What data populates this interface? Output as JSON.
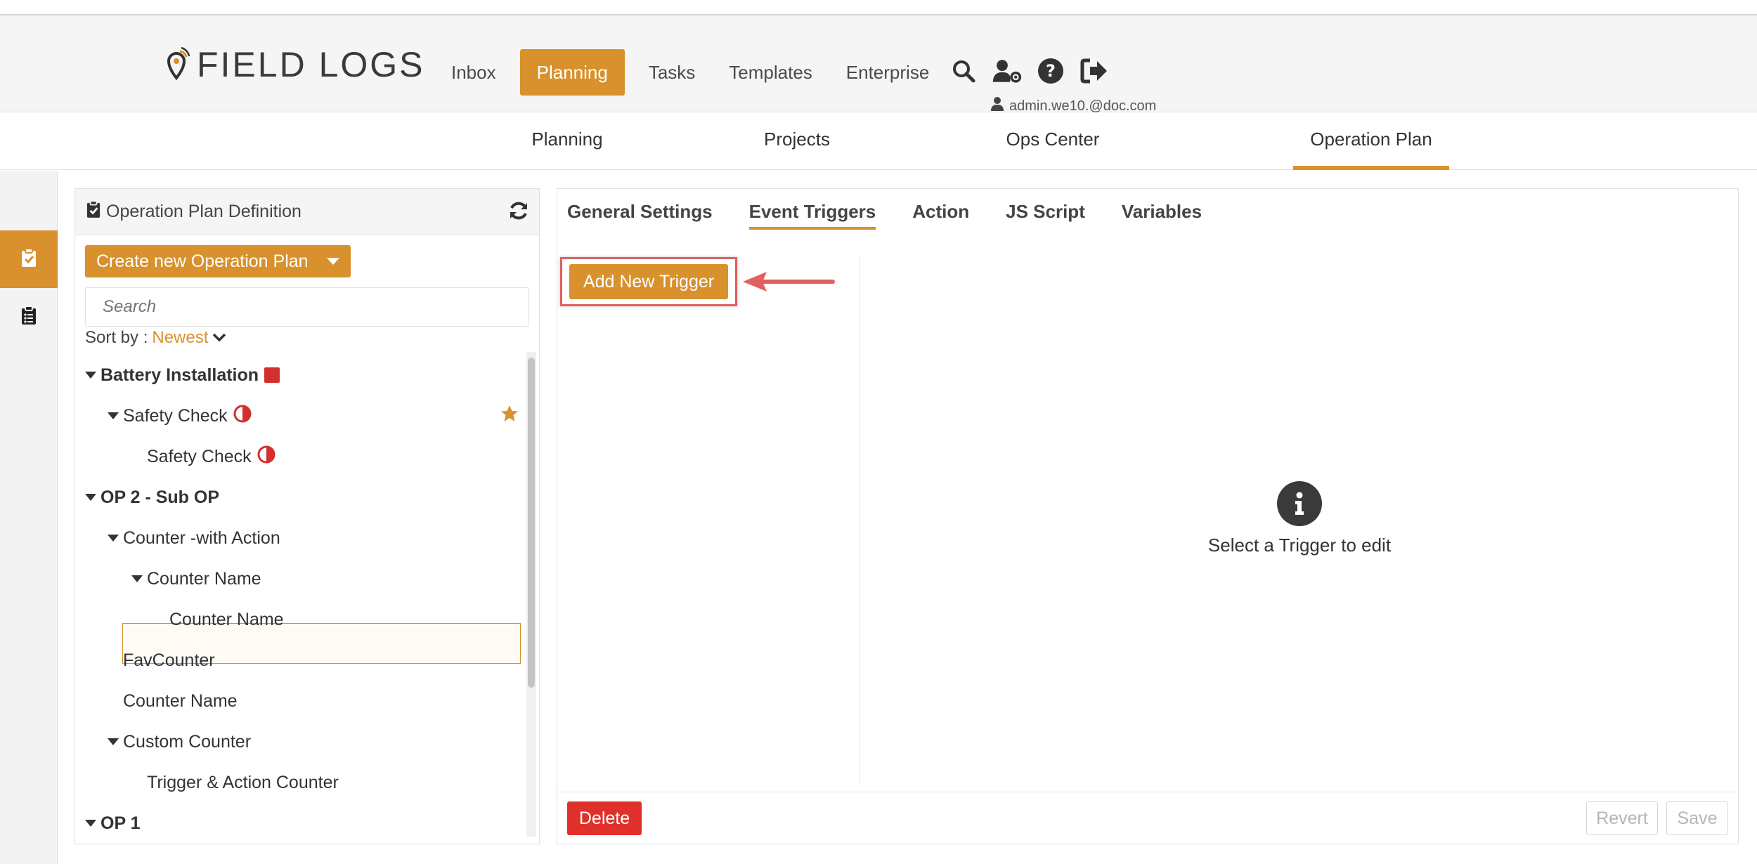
{
  "brand": {
    "name": "FIELD LOGS"
  },
  "nav": {
    "items": [
      {
        "label": "Inbox"
      },
      {
        "label": "Planning"
      },
      {
        "label": "Tasks"
      },
      {
        "label": "Templates"
      },
      {
        "label": "Enterprise"
      }
    ],
    "active": "Planning",
    "icons": [
      "search-icon",
      "user-settings-icon",
      "help-icon",
      "sign-out-icon"
    ],
    "user": "admin.we10.@doc.com"
  },
  "subnav": {
    "items": [
      {
        "label": "Planning"
      },
      {
        "label": "Projects"
      },
      {
        "label": "Ops Center"
      },
      {
        "label": "Operation Plan"
      }
    ],
    "active": "Operation Plan"
  },
  "left_panel": {
    "title": "Operation Plan Definition",
    "create_label": "Create new Operation Plan",
    "search_placeholder": "Search",
    "sort_label": "Sort by :",
    "sort_value": "Newest",
    "tree": [
      {
        "label": "Battery Installation",
        "level": 0,
        "bold": true,
        "expanded": true,
        "badge": "red-square"
      },
      {
        "label": "Safety Check",
        "level": 1,
        "expanded": true,
        "badge": "half-circle",
        "favorite": true
      },
      {
        "label": "Safety Check",
        "level": 2,
        "badge": "half-circle",
        "selected": true
      },
      {
        "label": "OP 2 - Sub OP",
        "level": 0,
        "bold": true,
        "expanded": true
      },
      {
        "label": "Counter -with Action",
        "level": 1,
        "expanded": true
      },
      {
        "label": "Counter Name",
        "level": 2,
        "expanded": true
      },
      {
        "label": "Counter Name",
        "level": 3
      },
      {
        "label": "FavCounter",
        "level": 1
      },
      {
        "label": "Counter Name",
        "level": 1
      },
      {
        "label": "Custom Counter",
        "level": 1,
        "expanded": true
      },
      {
        "label": "Trigger & Action Counter",
        "level": 2
      },
      {
        "label": "OP 1",
        "level": 0,
        "bold": true,
        "expanded": true
      }
    ]
  },
  "right_panel": {
    "tabs": [
      {
        "label": "General Settings"
      },
      {
        "label": "Event Triggers"
      },
      {
        "label": "Action"
      },
      {
        "label": "JS Script"
      },
      {
        "label": "Variables"
      }
    ],
    "active_tab": "Event Triggers",
    "add_trigger_label": "Add New Trigger",
    "empty_message": "Select a Trigger to edit",
    "delete_label": "Delete",
    "revert_label": "Revert",
    "save_label": "Save"
  },
  "colors": {
    "accent": "#d8912c",
    "danger": "#e0302a",
    "highlight_border": "#e06060"
  }
}
